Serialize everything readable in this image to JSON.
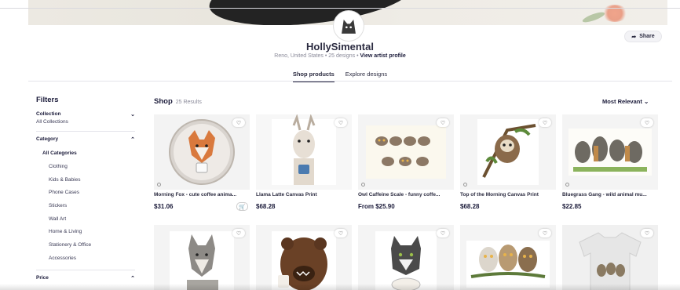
{
  "artist": {
    "name": "HollySimental",
    "location": "Reno, United States",
    "designs": "25 designs",
    "view_profile": "View artist profile",
    "share_label": "Share"
  },
  "tabs": [
    {
      "label": "Shop products",
      "active": true
    },
    {
      "label": "Explore designs",
      "active": false
    }
  ],
  "filters": {
    "title": "Filters",
    "collection": {
      "label": "Collection",
      "value": "All Collections"
    },
    "category": {
      "label": "Category",
      "items": [
        "All Categories",
        "Clothing",
        "Kids & Babies",
        "Phone Cases",
        "Stickers",
        "Wall Art",
        "Home & Living",
        "Stationery & Office",
        "Accessories"
      ]
    },
    "price": {
      "label": "Price"
    }
  },
  "shop": {
    "title": "Shop",
    "results": "25 Results",
    "sort_label": "Most Relevant"
  },
  "products": [
    {
      "title": "Morning Fox - cute coffee anima...",
      "price": "$31.06",
      "art": "fox"
    },
    {
      "title": "Llama Latte Canvas Print",
      "price": "$68.28",
      "art": "llama"
    },
    {
      "title": "Owl Caffeine Scale - funny coffe...",
      "price": "From $25.90",
      "art": "owls"
    },
    {
      "title": "Top of the Morning Canvas Print",
      "price": "$68.28",
      "art": "sloth"
    },
    {
      "title": "Bluegrass Gang - wild animal mu...",
      "price": "$22.85",
      "art": "band"
    },
    {
      "title": "",
      "price": "",
      "art": "wolf"
    },
    {
      "title": "",
      "price": "",
      "art": "bear"
    },
    {
      "title": "",
      "price": "",
      "art": "cat"
    },
    {
      "title": "",
      "price": "",
      "art": "owl-trio"
    },
    {
      "title": "",
      "price": "",
      "art": "tshirt"
    }
  ],
  "colors": {
    "accent": "#1b1b3a",
    "muted": "#8a8a99"
  }
}
